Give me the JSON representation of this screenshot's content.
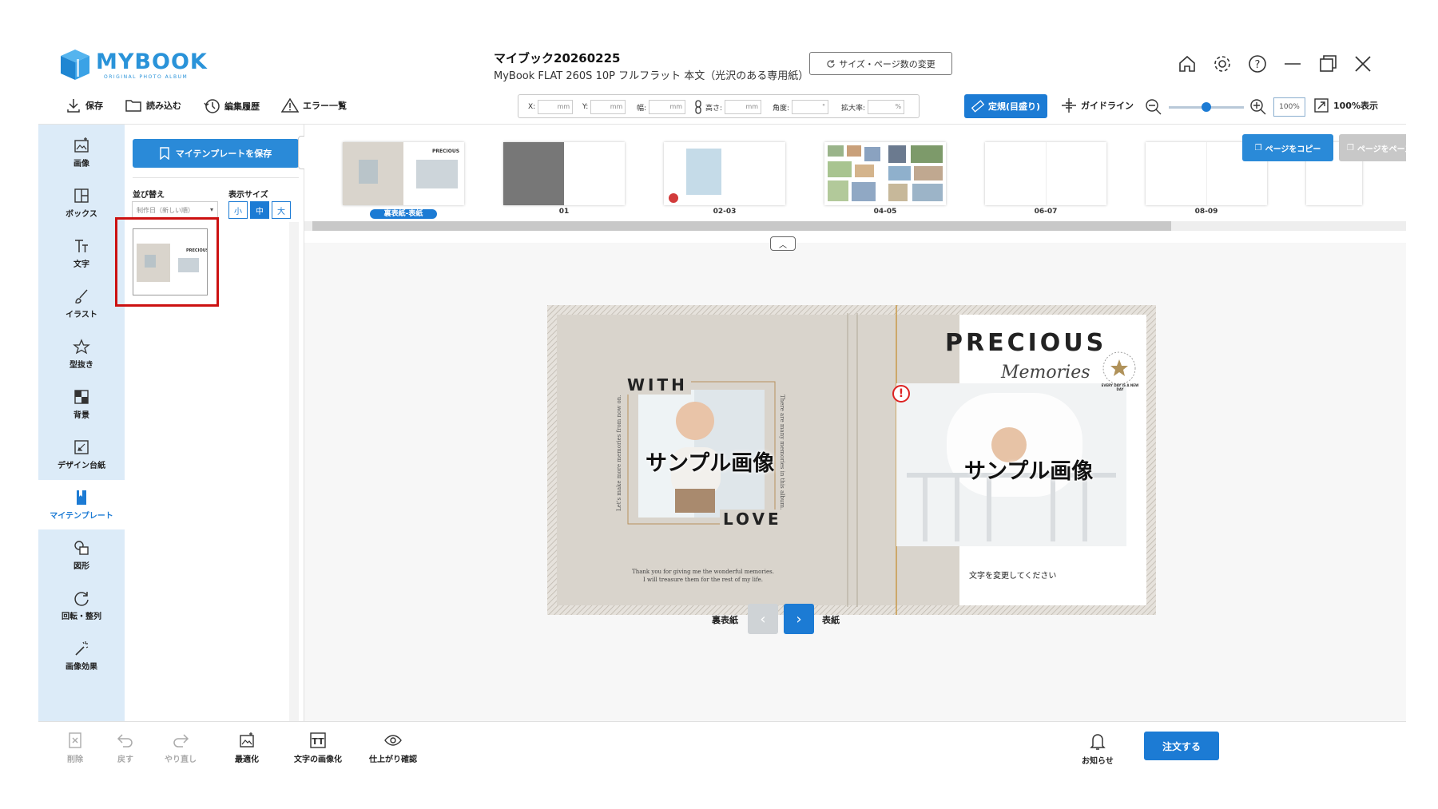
{
  "app": {
    "logo_text": "MYBOOK",
    "logo_sub": "ORIGINAL PHOTO ALBUM",
    "doc_title": "マイブック20260225",
    "doc_subtitle": "MyBook FLAT 260S 10P フルフラット 本文（光沢のある専用紙）",
    "size_change_label": "サイズ・ページ数の変更"
  },
  "window_icons": [
    "home-icon",
    "gear-icon",
    "help-icon",
    "minimize-icon",
    "restore-icon",
    "close-icon"
  ],
  "toolbar": {
    "save": "保存",
    "load": "読み込む",
    "history": "編集履歴",
    "errors": "エラー一覧",
    "fields": [
      {
        "label": "X:",
        "unit": "mm"
      },
      {
        "label": "Y:",
        "unit": "mm"
      },
      {
        "label": "幅:",
        "unit": "mm"
      },
      {
        "label": "高さ:",
        "unit": "mm"
      },
      {
        "label": "角度:",
        "unit": "°"
      },
      {
        "label": "拡大率:",
        "unit": "%"
      }
    ],
    "ruler": "定規(目盛り)",
    "guideline": "ガイドライン",
    "zoom_value": "100%",
    "fit_100": "100%表示"
  },
  "sidebar": {
    "items": [
      {
        "label": "画像",
        "icon": "image-add-icon"
      },
      {
        "label": "ボックス",
        "icon": "box-icon"
      },
      {
        "label": "文字",
        "icon": "text-icon"
      },
      {
        "label": "イラスト",
        "icon": "brush-icon"
      },
      {
        "label": "型抜き",
        "icon": "star-cut-icon"
      },
      {
        "label": "背景",
        "icon": "checker-icon"
      },
      {
        "label": "デザイン台紙",
        "icon": "design-mount-icon"
      },
      {
        "label": "マイテンプレート",
        "icon": "bookmark-icon"
      },
      {
        "label": "図形",
        "icon": "shape-icon"
      },
      {
        "label": "回転・整列",
        "icon": "rotate-icon"
      },
      {
        "label": "画像効果",
        "icon": "magic-wand-icon"
      }
    ]
  },
  "panel": {
    "save_template": "マイテンプレートを保存",
    "sort_label": "並び替え",
    "sort_value": "制作日（新しい順）",
    "size_label": "表示サイズ",
    "sizes": [
      "小",
      "中",
      "大"
    ]
  },
  "pages": {
    "labels": [
      "裏表紙-表紙",
      "01",
      "02-03",
      "04-05",
      "06-07",
      "08-09"
    ],
    "copy_page": "ページをコピー",
    "paste_page": "ページをペースト"
  },
  "spread": {
    "with": "WITH",
    "love": "LOVE",
    "left_vertical": "Let's make more memories from now on.",
    "right_vertical": "There are many memories in this album.",
    "thanks_line1": "Thank you for giving me the wonderful memories.",
    "thanks_line2": "I will treasure them for the rest of my life.",
    "sample": "サンプル画像",
    "precious": "PRECIOUS",
    "memories": "Memories",
    "badge": "EVERY DAY IS A NEW DAY",
    "change_text": "文字を変更してください",
    "error_mark": "!"
  },
  "nav": {
    "back_label": "裏表紙",
    "front_label": "表紙"
  },
  "bottom": {
    "delete": "削除",
    "undo": "戻す",
    "redo": "やり直し",
    "optimize": "最適化",
    "text_to_image": "文字の画像化",
    "preview": "仕上がり確認",
    "notice": "お知らせ",
    "order": "注文する"
  },
  "colors": {
    "accent": "#1c7bd4",
    "rail_bg": "#dcebf8",
    "spread_bg": "#d9d4cc",
    "highlight": "#cc1111"
  }
}
